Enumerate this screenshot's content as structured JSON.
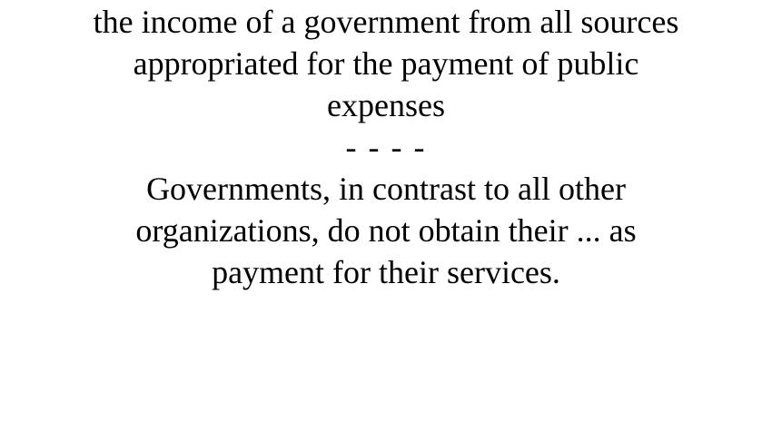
{
  "definition": {
    "lines": [
      "the income of a government from all sources",
      "appropriated for the payment of public",
      "expenses"
    ]
  },
  "separator": "- - - -",
  "example": {
    "lines": [
      "Governments, in contrast to all other",
      "organizations, do not obtain their ... as",
      "payment for their services."
    ]
  }
}
